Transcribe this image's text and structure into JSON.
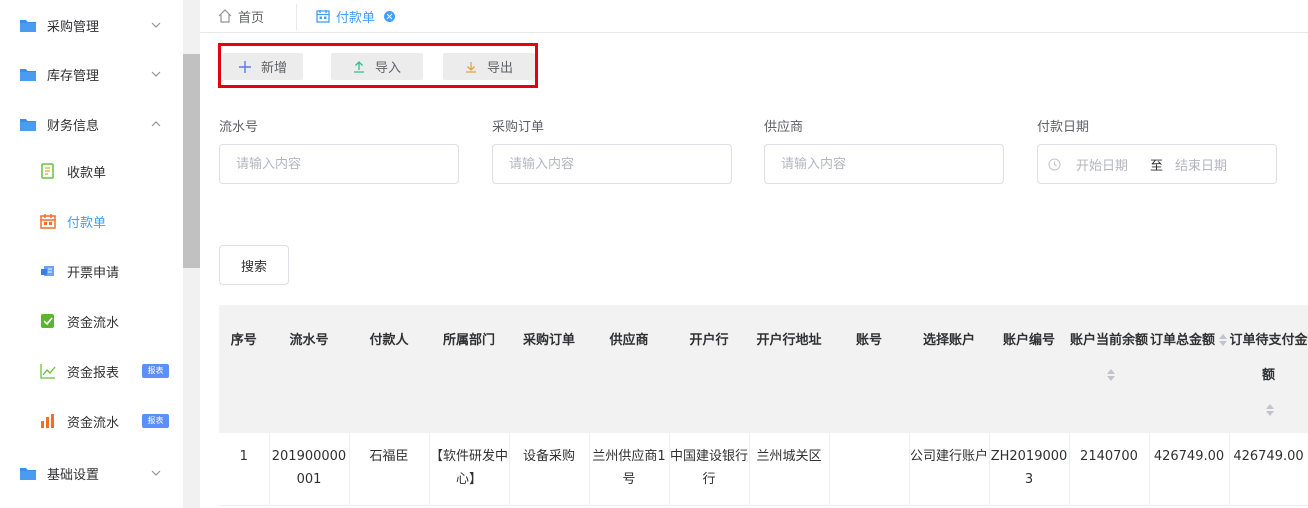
{
  "sidebar": {
    "items": [
      {
        "label": "采购管理",
        "icon": "folder-icon"
      },
      {
        "label": "库存管理",
        "icon": "folder-icon"
      },
      {
        "label": "财务信息",
        "icon": "folder-icon"
      },
      {
        "label": "收款单",
        "icon": "receipt-icon"
      },
      {
        "label": "付款单",
        "icon": "calendar-icon"
      },
      {
        "label": "开票申请",
        "icon": "invoice-icon"
      },
      {
        "label": "资金流水",
        "icon": "check-doc-icon"
      },
      {
        "label": "资金报表",
        "icon": "line-chart-icon",
        "badge": "报表"
      },
      {
        "label": "资金流水",
        "icon": "bar-chart-icon",
        "badge": "报表"
      },
      {
        "label": "基础设置",
        "icon": "folder-icon"
      }
    ]
  },
  "tabs": {
    "home": "首页",
    "current": "付款单"
  },
  "toolbar": {
    "add": "新增",
    "import": "导入",
    "export": "导出"
  },
  "filters": {
    "serial_label": "流水号",
    "order_label": "采购订单",
    "supplier_label": "供应商",
    "date_label": "付款日期",
    "placeholder": "请输入内容",
    "date_start": "开始日期",
    "date_sep": "至",
    "date_end": "结束日期"
  },
  "search_label": "搜索",
  "table": {
    "headers": [
      "序号",
      "流水号",
      "付款人",
      "所属部门",
      "采购订单",
      "供应商",
      "开户行",
      "开户行地址",
      "账号",
      "选择账户",
      "账户编号",
      "账户当前余额",
      "订单总金额",
      "订单待支付金额"
    ],
    "rows": [
      [
        "1",
        "201900000001",
        "石福臣",
        "【软件研发中心】",
        "设备采购",
        "兰州供应商1号",
        "中国建设银行行",
        "兰州城关区",
        "",
        "公司建行账户",
        "ZH20190003",
        "2140700",
        "426749.00",
        "426749.00"
      ]
    ]
  },
  "colors": {
    "accent": "#409eff",
    "highlight_border": "#e5000a",
    "badge": "#5b8ff9"
  }
}
